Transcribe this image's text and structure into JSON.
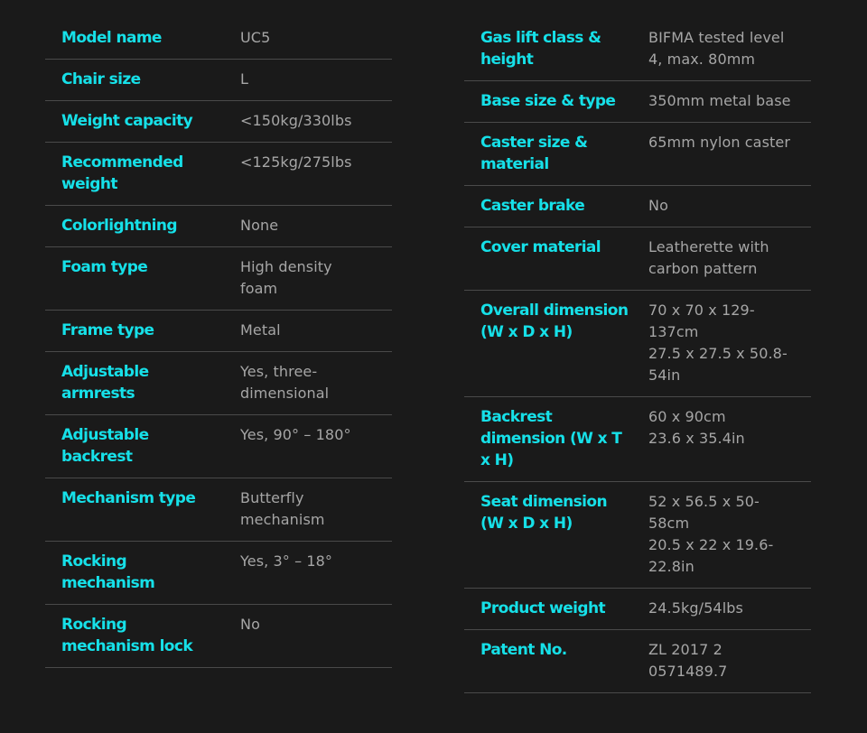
{
  "left_specs": [
    {
      "label": "Model name",
      "value": "UC5"
    },
    {
      "label": "Chair size",
      "value": "L"
    },
    {
      "label": "Weight capacity",
      "value": "<150kg/330lbs"
    },
    {
      "label": "Recommended\nweight",
      "value": "<125kg/275lbs"
    },
    {
      "label": "Colorlightning",
      "value": "None"
    },
    {
      "label": "Foam type",
      "value": "High density\nfoam"
    },
    {
      "label": "Frame type",
      "value": "Metal"
    },
    {
      "label": "Adjustable\narmrests",
      "value": "Yes, three-\ndimensional"
    },
    {
      "label": "Adjustable\nbackrest",
      "value": "Yes, 90° – 180°"
    },
    {
      "label": "Mechanism type",
      "value": "Butterfly\nmechanism"
    },
    {
      "label": "Rocking\nmechanism",
      "value": "Yes, 3° – 18°"
    },
    {
      "label": "Rocking\nmechanism lock",
      "value": "No"
    }
  ],
  "right_specs": [
    {
      "label": "Gas lift class &\nheight",
      "value": "BIFMA tested level\n4, max. 80mm"
    },
    {
      "label": "Base size & type",
      "value": "350mm metal base"
    },
    {
      "label": "Caster size &\nmaterial",
      "value": "65mm nylon caster"
    },
    {
      "label": "Caster brake",
      "value": "No"
    },
    {
      "label": "Cover material",
      "value": "Leatherette with\ncarbon pattern"
    },
    {
      "label": "Overall dimension\n(W x D x H)",
      "value": "70 x 70 x 129-\n137cm\n27.5 x 27.5 x 50.8-\n54in"
    },
    {
      "label": "Backrest\ndimension (W x T\nx H)",
      "value": "60 x 90cm\n23.6 x 35.4in"
    },
    {
      "label": "Seat dimension\n(W x D x H)",
      "value": "52 x 56.5 x 50-\n58cm\n20.5 x 22 x 19.6-\n22.8in"
    },
    {
      "label": "Product weight",
      "value": "24.5kg/54lbs"
    },
    {
      "label": "Patent No.",
      "value": "ZL 2017 2\n0571489.7"
    }
  ]
}
